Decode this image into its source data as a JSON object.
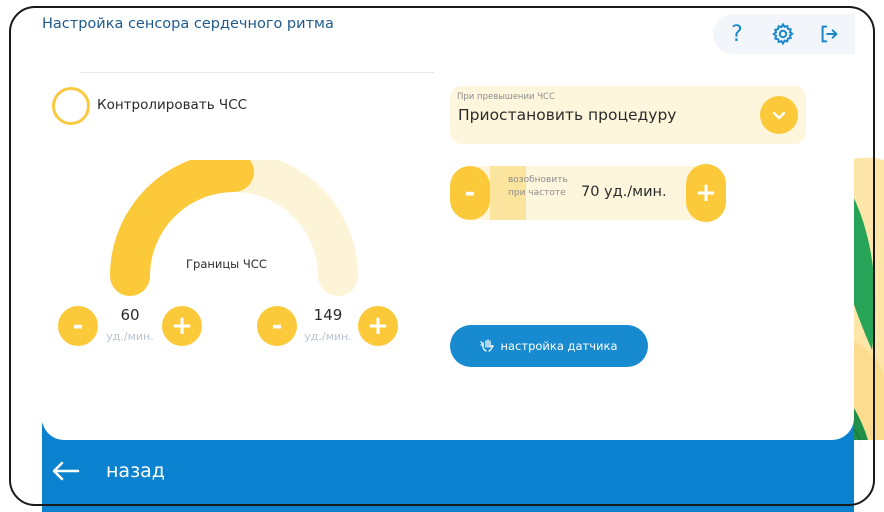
{
  "header": {
    "title": "Настройка сенсора сердечного ритма",
    "help_icon": "question-icon",
    "settings_icon": "gear-icon",
    "logout_icon": "logout-icon"
  },
  "monitor": {
    "label": "Контролировать ЧСС",
    "checked": false
  },
  "gauge": {
    "label": "Границы ЧСС",
    "fill_fraction": 0.5,
    "lower": {
      "value": "60",
      "unit": "уд./мин.",
      "minus": "-",
      "plus": "+"
    },
    "upper": {
      "value": "149",
      "unit": "уд./мин.",
      "minus": "-",
      "plus": "+"
    }
  },
  "on_exceed": {
    "caption": "При превышении ЧСС",
    "value": "Приостановить процедуру"
  },
  "resume": {
    "label": "возобновить при частоте",
    "value": "70 уд./мин.",
    "minus": "-",
    "plus": "+"
  },
  "sensor_settings": {
    "label": "настройка датчика",
    "icon": "hand-wave-icon"
  },
  "footer": {
    "back_label": "назад",
    "back_icon": "arrow-left-icon"
  },
  "colors": {
    "accent_yellow": "#fbc93a",
    "pale_yellow": "#fef6dc",
    "brand_blue": "#0a82cf",
    "leaf_green": "#1f9a4c"
  }
}
